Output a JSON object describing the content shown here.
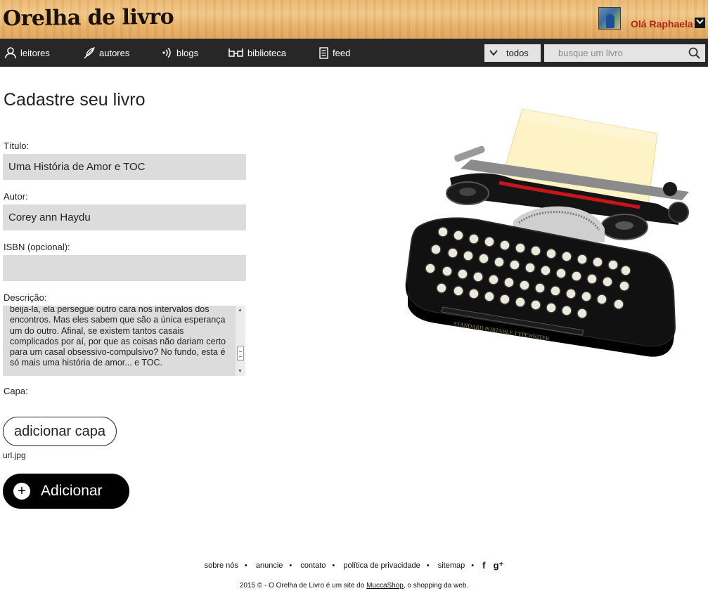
{
  "header": {
    "logo": "Orelha de livro",
    "greeting": "Olá Raphaela",
    "user_menu_icon": "chevron-down-icon"
  },
  "nav": {
    "items": [
      {
        "label": "leitores",
        "icon": "person-icon"
      },
      {
        "label": "autores",
        "icon": "quill-icon"
      },
      {
        "label": "blogs",
        "icon": "rss-icon"
      },
      {
        "label": "biblioteca",
        "icon": "glasses-icon"
      },
      {
        "label": "feed",
        "icon": "document-icon"
      }
    ],
    "filter": {
      "selected": "todos",
      "icon": "chevron-down-icon"
    },
    "search": {
      "placeholder": "busque um livro",
      "value": "",
      "icon": "search-icon"
    }
  },
  "form": {
    "title": "Cadastre seu livro",
    "titulo": {
      "label": "Título:",
      "value": "Uma História de Amor e TOC"
    },
    "autor": {
      "label": "Autor:",
      "value": "Corey ann Haydu"
    },
    "isbn": {
      "label": "ISBN (opcional):",
      "value": ""
    },
    "descricao": {
      "label": "Descrição:",
      "visible_text": "beija-la, ela persegue outro cara nos intervalos dos encontros. Mas eles sabem que são a única esperança um do outro. Afinal, se existem tantos casais complicados por aí, por que as coisas não dariam certo para um casal obsessivo-compulsivo? No fundo, esta é só mais uma história de amor... e TOC."
    },
    "capa": {
      "label": "Capa:",
      "button": "adicionar capa",
      "filename": "url.jpg"
    },
    "submit": {
      "label": "Adicionar",
      "icon": "plus-icon"
    }
  },
  "illustration": {
    "kind": "typewriter-photo",
    "brand_text": "STANDARD PORTABLE TYPEWRITER"
  },
  "footer": {
    "links": [
      "sobre nós",
      "anuncie",
      "contato",
      "política de privacidade",
      "sitemap"
    ],
    "social": [
      {
        "icon": "facebook-icon",
        "glyph": "f"
      },
      {
        "icon": "google-plus-icon",
        "glyph": "g⁺"
      }
    ],
    "copyright_prefix": "2015 © - O Orelha de Livro é um site do ",
    "copyright_link": "MuccaShop",
    "copyright_suffix": ", o shopping da web."
  },
  "colors": {
    "nav_bg": "#272727",
    "greeting": "#b0241b",
    "field_bg": "#dcdcdc",
    "button_dark": "#000000"
  }
}
